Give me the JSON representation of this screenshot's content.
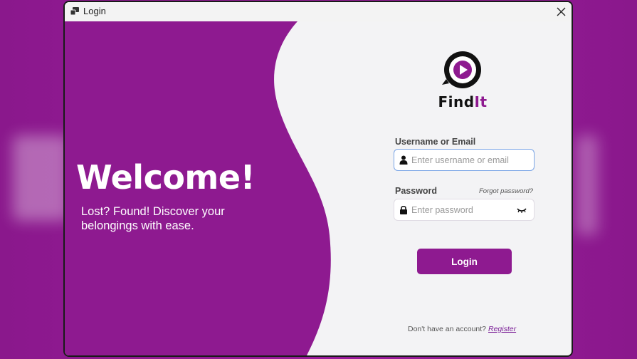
{
  "window": {
    "title": "Login",
    "close_symbol": "✕"
  },
  "hero": {
    "heading": "Welcome!",
    "tagline": "Lost? Found! Discover your belongings with ease."
  },
  "brand": {
    "name_part1": "Find",
    "name_part2": "It",
    "accent_color": "#8e1a90"
  },
  "form": {
    "username": {
      "label": "Username or Email",
      "placeholder": "Enter username or email",
      "icon": "user-icon"
    },
    "password": {
      "label": "Password",
      "placeholder": "Enter password",
      "icon": "lock-icon",
      "toggle_icon": "eye-closed-icon"
    },
    "forgot_link": "Forgot password?",
    "login_button": "Login"
  },
  "footer": {
    "prompt": "Don't have an account?",
    "register_link": "Register"
  }
}
